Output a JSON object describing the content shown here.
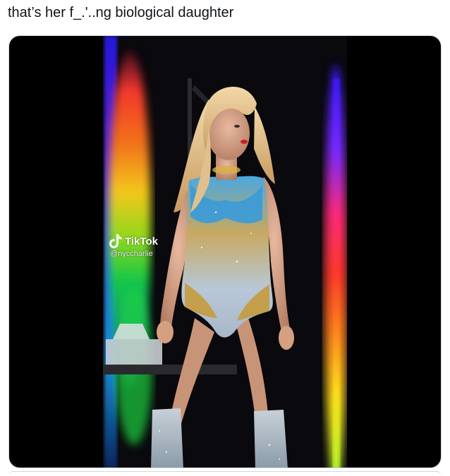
{
  "tweet": {
    "text": "that’s her f____ng biological daughter",
    "text_display": "that’s her f_.'..ng biological daughter"
  },
  "media": {
    "type": "video",
    "watermark": {
      "brand": "TikTok",
      "handle": "@nyccharlie",
      "icon": "tiktok-note-icon"
    }
  },
  "colors": {
    "text": "#0f1419",
    "card_background": "#000000",
    "card_border": "#cfd9de"
  }
}
